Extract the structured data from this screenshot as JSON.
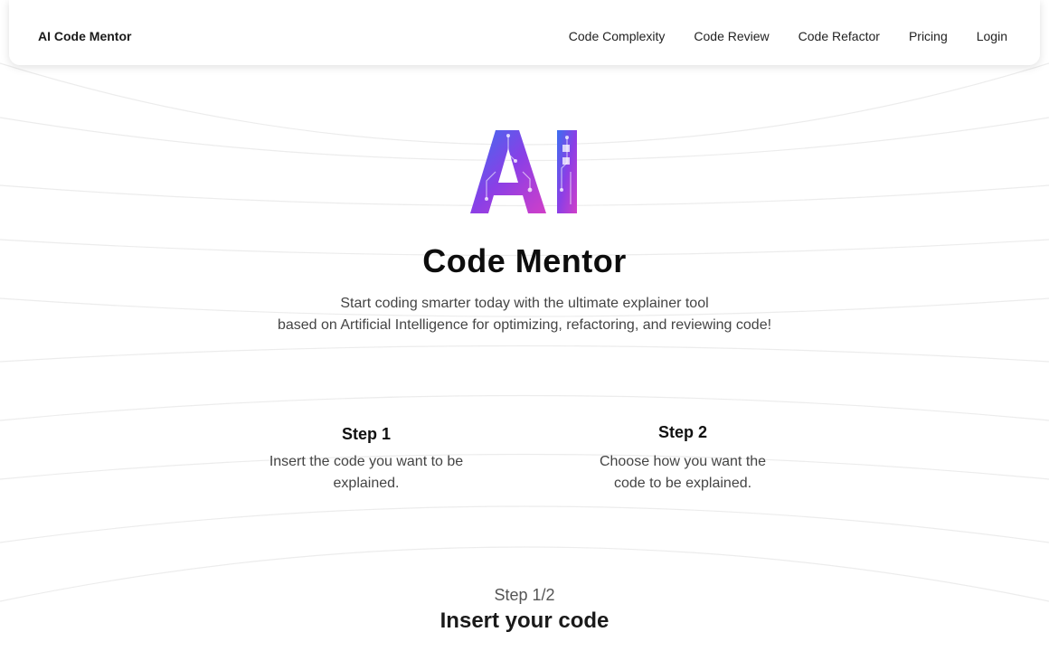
{
  "nav": {
    "brand": "AI Code Mentor",
    "links": [
      "Code Complexity",
      "Code Review",
      "Code Refactor",
      "Pricing",
      "Login"
    ]
  },
  "hero": {
    "logo_text": "AI",
    "title": "Code Mentor",
    "subtitle_line1": "Start coding smarter today with the ultimate explainer tool",
    "subtitle_line2": "based on Artificial Intelligence for optimizing, refactoring, and reviewing code!"
  },
  "steps": [
    {
      "title": "Step 1",
      "desc_line1": "Insert the code you want to be",
      "desc_line2": "explained."
    },
    {
      "title": "Step 2",
      "desc_line1": "Choose how you want the",
      "desc_line2": "code to be explained."
    }
  ],
  "progress": {
    "count": "Step 1/2",
    "heading": "Insert your code"
  },
  "colors": {
    "logo_gradient_start": "#3b6ff0",
    "logo_gradient_mid": "#8a3fe6",
    "logo_gradient_end": "#d13fc8"
  }
}
